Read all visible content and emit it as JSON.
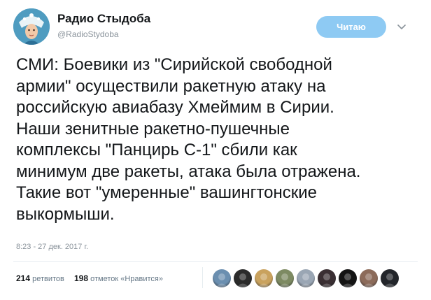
{
  "author": {
    "name": "Радио Стыдоба",
    "handle": "@RadioStydoba"
  },
  "follow_button": {
    "label": "Читаю"
  },
  "tweet": {
    "lines": [
      "СМИ: Боевики из \"Сирийской свободной",
      "армии\" осуществили ракетную атаку на",
      "российскую авиабазу Хмеймим в Сирии.",
      "Наши зенитные ракетно-пушечные",
      "комплексы \"Панцирь С-1\" сбили как",
      "минимум две ракеты, атака была отражена.",
      "Такие вот \"умеренные\" вашингтонские",
      "выкормыши."
    ]
  },
  "timestamp": "8:23 - 27 дек. 2017 г.",
  "stats": {
    "retweets_count": "214",
    "retweets_label": "ретвитов",
    "likes_count": "198",
    "likes_label": "отметок «Нравится»"
  },
  "likers": [
    {
      "icon": "avatar",
      "color": "#6b8fb0"
    },
    {
      "icon": "avatar",
      "color": "#2b2b2b"
    },
    {
      "icon": "avatar",
      "color": "#c9a25e"
    },
    {
      "icon": "avatar",
      "color": "#7d8a62"
    },
    {
      "icon": "avatar",
      "color": "#9aa6b4"
    },
    {
      "icon": "avatar",
      "color": "#3a2f33"
    },
    {
      "icon": "avatar",
      "color": "#141414"
    },
    {
      "icon": "avatar",
      "color": "#8c6b5a"
    },
    {
      "icon": "avatar",
      "color": "#23262b"
    }
  ],
  "colors": {
    "follow_button_bg": "#8ecaf3",
    "text": "#14171a",
    "muted": "#8a939b"
  }
}
